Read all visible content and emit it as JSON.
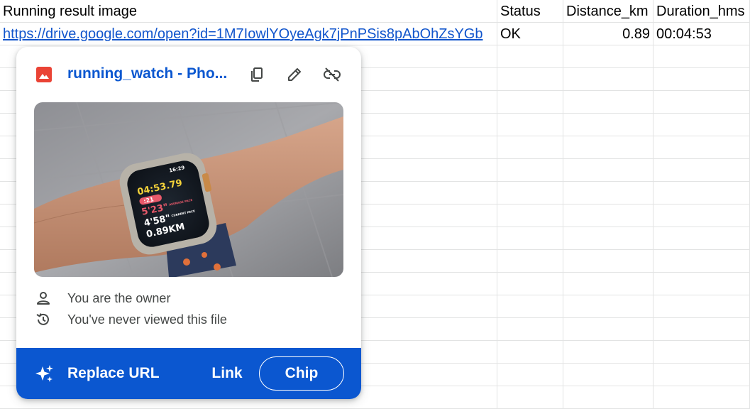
{
  "sheet": {
    "headers": {
      "a": "Running result image",
      "b": "Status",
      "c": "Distance_km",
      "d": "Duration_hms"
    },
    "row1": {
      "url": "https://drive.google.com/open?id=1M7IowlYOyeAgk7jPnPSis8pAbOhZsYGb",
      "status": "OK",
      "distance": "0.89",
      "duration": "00:04:53"
    }
  },
  "popup": {
    "file_icon": "image-file-icon",
    "title": "running_watch - Pho...",
    "actions": {
      "copy_icon": "copy-icon",
      "edit_icon": "pencil-icon",
      "unlink_icon": "unlink-icon"
    },
    "preview_image": {
      "watch_time": "16:29",
      "elapsed": "04:53.79",
      "pace_delta": ":21",
      "avg_pace": "5'23\"",
      "avg_pace_label": "AVERAGE PACE",
      "current_pace": "4'58\"",
      "current_pace_label": "CURRENT PACE",
      "distance": "0.89KM"
    },
    "owner_text": "You are the owner",
    "viewed_text": "You've never viewed this file",
    "footer": {
      "replace_label": "Replace URL",
      "link_label": "Link",
      "chip_label": "Chip"
    },
    "colors": {
      "accent": "#0b57d0",
      "image_icon": "#ea4335"
    }
  }
}
